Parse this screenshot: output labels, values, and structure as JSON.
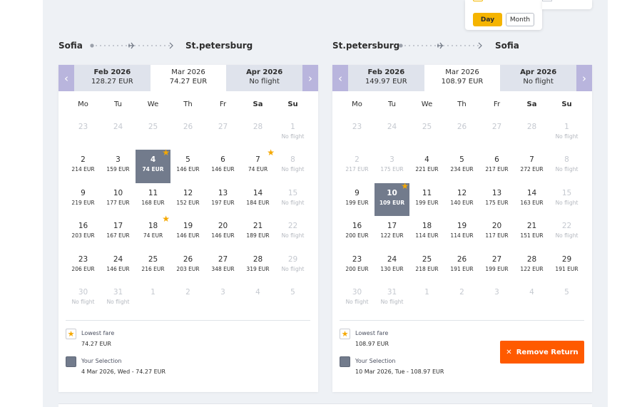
{
  "view_toggle": {
    "day_label": "Day",
    "month_label": "Month"
  },
  "outbound": {
    "from": "Sofia",
    "to": "St.petersburg",
    "months": [
      {
        "name": "Feb 2026",
        "price": "128.27 EUR"
      },
      {
        "name": "Mar 2026",
        "price": "74.27 EUR"
      },
      {
        "name": "Apr 2026",
        "price": "No flight"
      }
    ],
    "weekdays": [
      "Mo",
      "Tu",
      "We",
      "Th",
      "Fr",
      "Sa",
      "Su"
    ],
    "days": [
      {
        "d": "23",
        "p": "",
        "s": "muted"
      },
      {
        "d": "24",
        "p": "",
        "s": "muted"
      },
      {
        "d": "25",
        "p": "",
        "s": "muted"
      },
      {
        "d": "26",
        "p": "",
        "s": "muted"
      },
      {
        "d": "27",
        "p": "",
        "s": "muted"
      },
      {
        "d": "28",
        "p": "",
        "s": "muted"
      },
      {
        "d": "1",
        "p": "No flight",
        "s": "nf"
      },
      {
        "d": "2",
        "p": "214 EUR"
      },
      {
        "d": "3",
        "p": "159 EUR"
      },
      {
        "d": "4",
        "p": "74 EUR",
        "s": "sel",
        "star": true
      },
      {
        "d": "5",
        "p": "146 EUR"
      },
      {
        "d": "6",
        "p": "146 EUR"
      },
      {
        "d": "7",
        "p": "74 EUR",
        "star": true
      },
      {
        "d": "8",
        "p": "No flight",
        "s": "nf"
      },
      {
        "d": "9",
        "p": "219 EUR"
      },
      {
        "d": "10",
        "p": "177 EUR"
      },
      {
        "d": "11",
        "p": "168 EUR"
      },
      {
        "d": "12",
        "p": "152 EUR"
      },
      {
        "d": "13",
        "p": "197 EUR"
      },
      {
        "d": "14",
        "p": "184 EUR"
      },
      {
        "d": "15",
        "p": "No flight",
        "s": "nf"
      },
      {
        "d": "16",
        "p": "203 EUR"
      },
      {
        "d": "17",
        "p": "167 EUR"
      },
      {
        "d": "18",
        "p": "74 EUR",
        "star": true
      },
      {
        "d": "19",
        "p": "146 EUR"
      },
      {
        "d": "20",
        "p": "146 EUR"
      },
      {
        "d": "21",
        "p": "189 EUR"
      },
      {
        "d": "22",
        "p": "No flight",
        "s": "nf"
      },
      {
        "d": "23",
        "p": "206 EUR"
      },
      {
        "d": "24",
        "p": "146 EUR"
      },
      {
        "d": "25",
        "p": "216 EUR"
      },
      {
        "d": "26",
        "p": "203 EUR"
      },
      {
        "d": "27",
        "p": "348 EUR"
      },
      {
        "d": "28",
        "p": "319 EUR"
      },
      {
        "d": "29",
        "p": "No flight",
        "s": "nf"
      },
      {
        "d": "30",
        "p": "No flight",
        "s": "nf"
      },
      {
        "d": "31",
        "p": "No flight",
        "s": "nf"
      },
      {
        "d": "1",
        "p": "",
        "s": "muted"
      },
      {
        "d": "2",
        "p": "",
        "s": "muted"
      },
      {
        "d": "3",
        "p": "",
        "s": "muted"
      },
      {
        "d": "4",
        "p": "",
        "s": "muted"
      },
      {
        "d": "5",
        "p": "",
        "s": "muted"
      }
    ],
    "legend": {
      "lowest_label": "Lowest fare",
      "lowest_value": "74.27 EUR",
      "selection_label": "Your Selection",
      "selection_value": "4 Mar 2026, Wed - 74.27 EUR"
    }
  },
  "return": {
    "from": "St.petersburg",
    "to": "Sofia",
    "months": [
      {
        "name": "Feb 2026",
        "price": "149.97 EUR"
      },
      {
        "name": "Mar 2026",
        "price": "108.97 EUR"
      },
      {
        "name": "Apr 2026",
        "price": "No flight"
      }
    ],
    "weekdays": [
      "Mo",
      "Tu",
      "We",
      "Th",
      "Fr",
      "Sa",
      "Su"
    ],
    "days": [
      {
        "d": "23",
        "p": "",
        "s": "muted"
      },
      {
        "d": "24",
        "p": "",
        "s": "muted"
      },
      {
        "d": "25",
        "p": "",
        "s": "muted"
      },
      {
        "d": "26",
        "p": "",
        "s": "muted"
      },
      {
        "d": "27",
        "p": "",
        "s": "muted"
      },
      {
        "d": "28",
        "p": "",
        "s": "muted"
      },
      {
        "d": "1",
        "p": "No flight",
        "s": "nf"
      },
      {
        "d": "2",
        "p": "217 EUR",
        "s": "muted"
      },
      {
        "d": "3",
        "p": "175 EUR",
        "s": "muted"
      },
      {
        "d": "4",
        "p": "221 EUR"
      },
      {
        "d": "5",
        "p": "234 EUR"
      },
      {
        "d": "6",
        "p": "217 EUR"
      },
      {
        "d": "7",
        "p": "272 EUR"
      },
      {
        "d": "8",
        "p": "No flight",
        "s": "nf"
      },
      {
        "d": "9",
        "p": "199 EUR"
      },
      {
        "d": "10",
        "p": "109 EUR",
        "s": "sel",
        "star": true
      },
      {
        "d": "11",
        "p": "199 EUR"
      },
      {
        "d": "12",
        "p": "140 EUR"
      },
      {
        "d": "13",
        "p": "175 EUR"
      },
      {
        "d": "14",
        "p": "163 EUR"
      },
      {
        "d": "15",
        "p": "No flight",
        "s": "nf"
      },
      {
        "d": "16",
        "p": "200 EUR"
      },
      {
        "d": "17",
        "p": "122 EUR"
      },
      {
        "d": "18",
        "p": "114 EUR"
      },
      {
        "d": "19",
        "p": "114 EUR"
      },
      {
        "d": "20",
        "p": "117 EUR"
      },
      {
        "d": "21",
        "p": "151 EUR"
      },
      {
        "d": "22",
        "p": "No flight",
        "s": "nf"
      },
      {
        "d": "23",
        "p": "200 EUR"
      },
      {
        "d": "24",
        "p": "130 EUR"
      },
      {
        "d": "25",
        "p": "218 EUR"
      },
      {
        "d": "26",
        "p": "191 EUR"
      },
      {
        "d": "27",
        "p": "199 EUR"
      },
      {
        "d": "28",
        "p": "122 EUR"
      },
      {
        "d": "29",
        "p": "191 EUR"
      },
      {
        "d": "30",
        "p": "No flight",
        "s": "nf"
      },
      {
        "d": "31",
        "p": "No flight",
        "s": "nf"
      },
      {
        "d": "1",
        "p": "",
        "s": "muted"
      },
      {
        "d": "2",
        "p": "",
        "s": "muted"
      },
      {
        "d": "3",
        "p": "",
        "s": "muted"
      },
      {
        "d": "4",
        "p": "",
        "s": "muted"
      },
      {
        "d": "5",
        "p": "",
        "s": "muted"
      }
    ],
    "legend": {
      "lowest_label": "Lowest fare",
      "lowest_value": "108.97 EUR",
      "selection_label": "Your Selection",
      "selection_value": "10 Mar 2026, Tue - 108.97 EUR"
    },
    "remove_label": "Remove Return"
  },
  "colors": {
    "accent_nav": "#b9b5dd",
    "selected": "#727b8c",
    "star": "#f5a800",
    "remove_button": "#ff5a00",
    "day_button": "#f5b400"
  },
  "icons": {
    "nav_prev": "chevron-left-icon",
    "nav_next": "chevron-right-icon",
    "star": "star-icon",
    "route": "plane-icon",
    "remove": "close-icon"
  }
}
